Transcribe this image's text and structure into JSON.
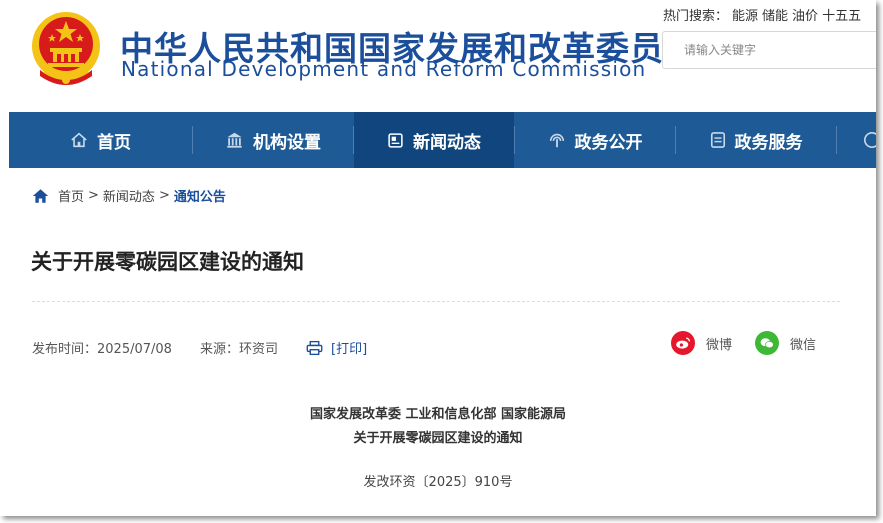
{
  "header": {
    "title_cn": "中华人民共和国国家发展和改革委员会",
    "title_en": "National Development and Reform Commission",
    "hot_label": "热门搜索：",
    "hot_terms": [
      "能源",
      "储能",
      "油价",
      "十五五"
    ],
    "search_placeholder": "请输入关键字"
  },
  "nav": {
    "items": [
      {
        "label": "首页",
        "icon": "home-icon"
      },
      {
        "label": "机构设置",
        "icon": "building-icon"
      },
      {
        "label": "新闻动态",
        "icon": "news-icon",
        "active": true
      },
      {
        "label": "政务公开",
        "icon": "broadcast-icon"
      },
      {
        "label": "政务服务",
        "icon": "document-icon"
      }
    ]
  },
  "breadcrumb": {
    "home": "首页",
    "sep": ">",
    "section": "新闻动态",
    "current": "通知公告"
  },
  "article": {
    "title": "关于开展零碳园区建设的通知",
    "publish_time": "发布时间：2025/07/08",
    "source": "来源：环资司",
    "print_label": "[打印]",
    "share_weibo": "微博",
    "share_wechat": "微信",
    "issuer_line1": "国家发展改革委 工业和信息化部 国家能源局",
    "issuer_line2": "关于开展零碳园区建设的通知",
    "doc_number": "发改环资〔2025〕910号"
  },
  "colors": {
    "brand_blue": "#1b4f9c",
    "nav_bg": "#1e5b96",
    "nav_active": "#11457d",
    "weibo_red": "#e6162d",
    "wechat_green": "#3fb838",
    "emblem_red": "#d71a1a",
    "emblem_gold": "#f4c317"
  }
}
